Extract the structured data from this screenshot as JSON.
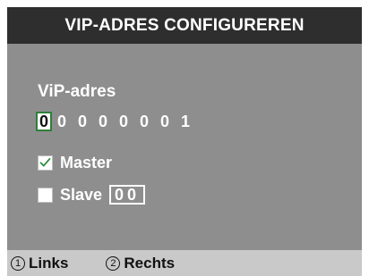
{
  "title": "VIP-ADRES CONFIGUREREN",
  "address": {
    "label": "ViP-adres",
    "digits": [
      "0",
      "0",
      "0",
      "0",
      "0",
      "0",
      "0",
      "1"
    ],
    "active_index": 0
  },
  "options": {
    "master": {
      "label": "Master",
      "checked": true,
      "check_icon": "check-icon"
    },
    "slave": {
      "label": "Slave",
      "checked": false,
      "value": "00"
    }
  },
  "footer": {
    "left": {
      "number": "1",
      "label": "Links"
    },
    "right": {
      "number": "2",
      "label": "Rechts"
    }
  },
  "colors": {
    "title_bg": "#2e2e2e",
    "panel_bg": "#8e8e8e",
    "footer_bg": "#c9c9c9",
    "focus_border": "#2f7f3a",
    "check_mark": "#2f8f3f"
  }
}
